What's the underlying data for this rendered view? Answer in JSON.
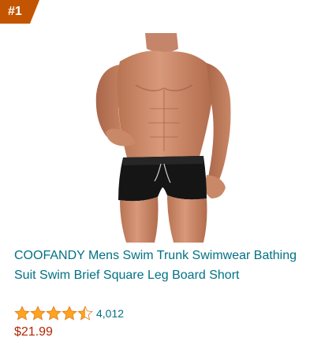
{
  "product": {
    "rank": "#1",
    "title": "COOFANDY Mens Swim Trunk Swimwear Bathing Suit Swim Brief Square Leg Board Short",
    "rating": 4.5,
    "rating_max": 5,
    "review_count": "4,012",
    "price": "$21.99"
  },
  "colors": {
    "badge": "#c45500",
    "link": "#007185",
    "star": "#ffa41c",
    "price": "#b12704"
  },
  "icons": {
    "stars": [
      "star-full-icon",
      "star-full-icon",
      "star-full-icon",
      "star-full-icon",
      "star-half-icon"
    ]
  }
}
